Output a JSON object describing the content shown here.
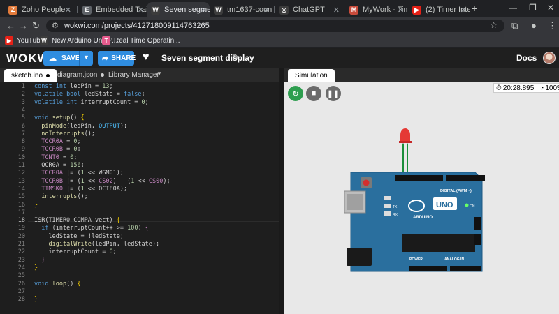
{
  "browser": {
    "tabs": [
      {
        "title": "Zoho People",
        "icon_text": "Z",
        "color": "#e37b3b"
      },
      {
        "title": "Embedded Trai",
        "icon_text": "E",
        "color": "#5f6368"
      },
      {
        "title": "Seven segment c",
        "icon_text": "W",
        "color": "#3c3c3c",
        "active": true
      },
      {
        "title": "tm1637-counter",
        "icon_text": "W",
        "color": "#3c3c3c"
      },
      {
        "title": "ChatGPT",
        "icon_text": "◎",
        "color": "#3c3c3c"
      },
      {
        "title": "MyWork - Time",
        "icon_text": "M",
        "color": "#c94b3b"
      },
      {
        "title": "(2) Timer Interru",
        "icon_text": "▶",
        "color": "#e62117"
      }
    ],
    "url": "wokwi.com/projects/412718009114763265",
    "bookmarks": [
      {
        "label": "YouTube",
        "icon_text": "▶",
        "color": "#e62117"
      },
      {
        "label": "New Arduino Uno P...",
        "icon_text": "W",
        "color": "#3c3c3c"
      },
      {
        "label": "Real Time Operatin...",
        "icon_text": "T",
        "color": "#e55b8d"
      }
    ]
  },
  "header": {
    "logo": "WOKWI",
    "save_label": "SAVE",
    "share_label": "SHARE",
    "project_title": "Seven segment display",
    "docs_label": "Docs"
  },
  "editor": {
    "tabs": [
      "sketch.ino",
      "diagram.json",
      "Library Manager"
    ],
    "current_line": 18,
    "lines": [
      [
        [
          "kw",
          "const "
        ],
        [
          "kw",
          "int "
        ],
        [
          "tx",
          "ledPin = "
        ],
        [
          "nm",
          "13"
        ],
        [
          "tx",
          ";"
        ]
      ],
      [
        [
          "kw",
          "volatile "
        ],
        [
          "kw",
          "bool "
        ],
        [
          "tx",
          "ledState = "
        ],
        [
          "kw",
          "false"
        ],
        [
          "tx",
          ";"
        ]
      ],
      [
        [
          "kw",
          "volatile "
        ],
        [
          "kw",
          "int "
        ],
        [
          "tx",
          "interruptCount = "
        ],
        [
          "nm",
          "0"
        ],
        [
          "tx",
          ";"
        ]
      ],
      [],
      [
        [
          "kw",
          "void "
        ],
        [
          "fnd",
          "setup"
        ],
        [
          "tx",
          "() "
        ],
        [
          "br",
          "{"
        ]
      ],
      [
        [
          "tx",
          "  "
        ],
        [
          "fnd",
          "pinMode"
        ],
        [
          "tx",
          "(ledPin, "
        ],
        [
          "df",
          "OUTPUT"
        ],
        [
          "tx",
          ");"
        ]
      ],
      [
        [
          "tx",
          "  "
        ],
        [
          "fnd",
          "noInterrupts"
        ],
        [
          "tx",
          "();"
        ]
      ],
      [
        [
          "tx",
          "  "
        ],
        [
          "reg",
          "TCCR0A"
        ],
        [
          "tx",
          " = "
        ],
        [
          "nm",
          "0"
        ],
        [
          "tx",
          ";"
        ]
      ],
      [
        [
          "tx",
          "  "
        ],
        [
          "reg",
          "TCCR0B"
        ],
        [
          "tx",
          " = "
        ],
        [
          "nm",
          "0"
        ],
        [
          "tx",
          ";"
        ]
      ],
      [
        [
          "tx",
          "  "
        ],
        [
          "reg",
          "TCNT0"
        ],
        [
          "tx",
          " = "
        ],
        [
          "nm",
          "0"
        ],
        [
          "tx",
          ";"
        ]
      ],
      [
        [
          "tx",
          "  "
        ],
        [
          "tx",
          "OCR0A = "
        ],
        [
          "nm",
          "156"
        ],
        [
          "tx",
          ";"
        ]
      ],
      [
        [
          "tx",
          "  "
        ],
        [
          "reg",
          "TCCR0A"
        ],
        [
          "tx",
          " |= ("
        ],
        [
          "nm",
          "1"
        ],
        [
          "tx",
          " << WGM01);"
        ]
      ],
      [
        [
          "tx",
          "  "
        ],
        [
          "reg",
          "TCCR0B"
        ],
        [
          "tx",
          " |= ("
        ],
        [
          "nm",
          "1"
        ],
        [
          "tx",
          " << "
        ],
        [
          "reg",
          "CS02"
        ],
        [
          "tx",
          ") | ("
        ],
        [
          "nm",
          "1"
        ],
        [
          "tx",
          " << "
        ],
        [
          "reg",
          "CS00"
        ],
        [
          "tx",
          ");"
        ]
      ],
      [
        [
          "tx",
          "  "
        ],
        [
          "reg",
          "TIMSK0"
        ],
        [
          "tx",
          " |= ("
        ],
        [
          "nm",
          "1"
        ],
        [
          "tx",
          " << OCIE0A);"
        ]
      ],
      [
        [
          "tx",
          "  "
        ],
        [
          "fnd",
          "interrupts"
        ],
        [
          "tx",
          "();"
        ]
      ],
      [
        [
          "br",
          "}"
        ]
      ],
      [],
      [
        [
          "tx",
          "ISR(TIMER0_COMPA_vect) "
        ],
        [
          "br",
          "{"
        ]
      ],
      [
        [
          "tx",
          "  "
        ],
        [
          "kw",
          "if "
        ],
        [
          "tx",
          "(interruptCount++ >= "
        ],
        [
          "nm",
          "100"
        ],
        [
          "tx",
          ") "
        ],
        [
          "fn2",
          "{"
        ]
      ],
      [
        [
          "tx",
          "    ledState = !ledState;"
        ]
      ],
      [
        [
          "tx",
          "    "
        ],
        [
          "fnd",
          "digitalWrite"
        ],
        [
          "tx",
          "(ledPin, ledState);"
        ]
      ],
      [
        [
          "tx",
          "    interruptCount = "
        ],
        [
          "nm",
          "0"
        ],
        [
          "tx",
          ";"
        ]
      ],
      [
        [
          "tx",
          "  "
        ],
        [
          "fn2",
          "}"
        ]
      ],
      [
        [
          "br",
          "}"
        ]
      ],
      [],
      [
        [
          "kw",
          "void "
        ],
        [
          "fnd",
          "loop"
        ],
        [
          "tx",
          "() "
        ],
        [
          "br",
          "{"
        ]
      ],
      [],
      [
        [
          "br",
          "}"
        ]
      ]
    ]
  },
  "simulation": {
    "tab_label": "Simulation",
    "elapsed": "20:28.895",
    "speed": "100%",
    "board": {
      "name": "UNO",
      "brand": "ARDUINO",
      "digital_label": "DIGITAL (PWM ~)",
      "analog_label": "ANALOG IN",
      "power_label": "POWER",
      "on_label": "ON",
      "tx_label": "TX",
      "rx_label": "RX",
      "l_label": "L"
    }
  },
  "colors": {
    "accent": "#2f8de0",
    "board": "#2a6f9e",
    "led": "#e53935",
    "restart": "#2e9e4f",
    "sim_button": "#6b6b6b"
  }
}
